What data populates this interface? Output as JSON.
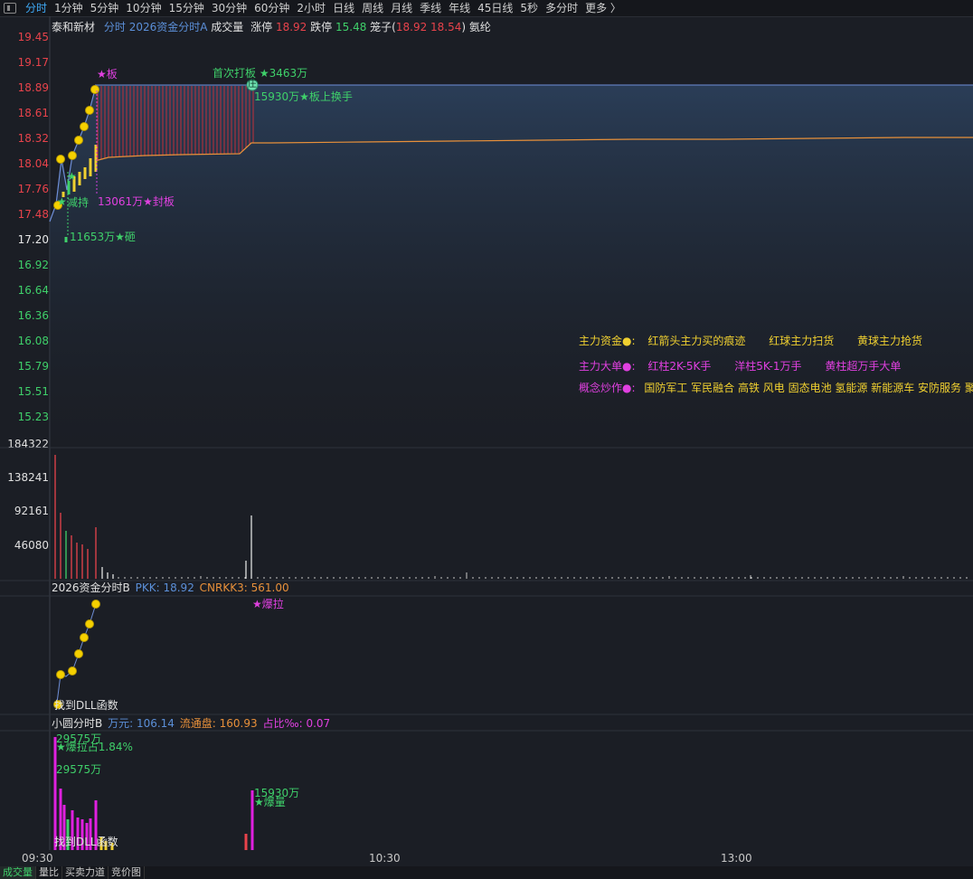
{
  "toolbar": {
    "tabs": [
      "分时",
      "1分钟",
      "5分钟",
      "10分钟",
      "15分钟",
      "30分钟",
      "60分钟",
      "2小时",
      "日线",
      "周线",
      "月线",
      "季线",
      "年线",
      "45日线",
      "5秒",
      "多分时",
      "更多 〉"
    ],
    "active": 0
  },
  "header": {
    "stock_name": "泰和新材",
    "view": "分时",
    "indicator": "2026资金分时A",
    "volume_label": "成交量",
    "limit_up_label": "涨停",
    "limit_up_value": "18.92",
    "limit_down_label": "跌停",
    "limit_down_value": "15.48",
    "cage_label": "笼子(",
    "cage_value": "18.92 18.54",
    "cage_close": ")",
    "concept": "氨纶"
  },
  "price_axis": [
    {
      "label": "19.45",
      "color": "#e8434b"
    },
    {
      "label": "19.17",
      "color": "#e8434b"
    },
    {
      "label": "18.89",
      "color": "#e8434b"
    },
    {
      "label": "18.61",
      "color": "#e8434b"
    },
    {
      "label": "18.32",
      "color": "#e8434b"
    },
    {
      "label": "18.04",
      "color": "#e8434b"
    },
    {
      "label": "17.76",
      "color": "#e8434b"
    },
    {
      "label": "17.48",
      "color": "#e8434b"
    },
    {
      "label": "17.20",
      "color": "#e8e8e8"
    },
    {
      "label": "16.92",
      "color": "#3fd06a"
    },
    {
      "label": "16.64",
      "color": "#3fd06a"
    },
    {
      "label": "16.36",
      "color": "#3fd06a"
    },
    {
      "label": "16.08",
      "color": "#3fd06a"
    },
    {
      "label": "15.79",
      "color": "#3fd06a"
    },
    {
      "label": "15.51",
      "color": "#3fd06a"
    },
    {
      "label": "15.23",
      "color": "#3fd06a"
    }
  ],
  "price_annotations": {
    "board": "★板",
    "first_board": "首次打板 ★3463万",
    "circle_mark": "庄",
    "turnover": "15930万★板上换手",
    "reduce": "减持",
    "reduce_star": "★",
    "seal": "13061万★封板",
    "smash": "11653万★砸",
    "green_star": "★"
  },
  "legend": {
    "row1_title": "主力资金●:",
    "row1_items": [
      "红箭头主力买的痕迹",
      "红球主力扫货",
      "黄球主力抢货"
    ],
    "row2_title": "主力大单●:",
    "row2_items": [
      "红柱2K-5K手",
      "洋柱5K-1万手",
      "黄柱超万手大单"
    ],
    "row3_title": "概念炒作●:",
    "row3_text": "国防军工 军民融合 高铁 风电 固态电池 氢能源 新能源车 安防服务 聚"
  },
  "volume_axis": [
    "184322",
    "138241",
    "92161",
    "46080"
  ],
  "panel_b": {
    "title": "2026资金分时B",
    "pkk_label": "PKK:",
    "pkk_value": "18.92",
    "cnrkk_label": "CNRKK3:",
    "cnrkk_value": "561.00",
    "burst": "★爆拉",
    "dll": "找到DLL函数"
  },
  "panel_c": {
    "title": "小圆分时B",
    "wan_label": "万元:",
    "wan_value": "106.14",
    "float_label": "流通盘:",
    "float_value": "160.93",
    "ratio_label": "占比‰:",
    "ratio_value": "0.07",
    "amount1": "29575万",
    "burst_ratio": "★爆拉占1.84%",
    "amount2": "29575万",
    "amount3": "15930万",
    "burst_volume": "★爆量",
    "dll": "找到DLL函数"
  },
  "time_axis": [
    "09:30",
    "10:30",
    "13:00"
  ],
  "bottom_tabs": [
    "成交量",
    "量比",
    "买卖力道",
    "竞价图"
  ],
  "chart_data": {
    "type": "line",
    "title": "",
    "price_ticks": [
      19.45,
      19.17,
      18.89,
      18.61,
      18.32,
      18.04,
      17.76,
      17.48,
      17.2,
      16.92,
      16.64,
      16.36,
      16.08,
      15.79,
      15.51,
      15.23
    ],
    "limit_up": 18.92,
    "limit_down": 15.48,
    "series": [
      {
        "name": "price",
        "values": [
          17.35,
          17.55,
          18.05,
          17.72,
          18.1,
          18.3,
          18.6,
          18.92,
          18.92,
          18.92,
          18.92,
          18.92,
          18.92,
          18.92,
          18.92,
          18.92,
          18.92,
          18.92,
          18.92,
          18.92
        ]
      },
      {
        "name": "average",
        "values": [
          17.35,
          17.45,
          17.7,
          17.75,
          17.85,
          17.95,
          18.02,
          18.06,
          18.08,
          18.1,
          18.12,
          18.2,
          18.24,
          18.25,
          18.26,
          18.27,
          18.28,
          18.29,
          18.3,
          18.31
        ]
      }
    ],
    "volume_ticks": [
      184322,
      138241,
      92161,
      46080
    ]
  }
}
